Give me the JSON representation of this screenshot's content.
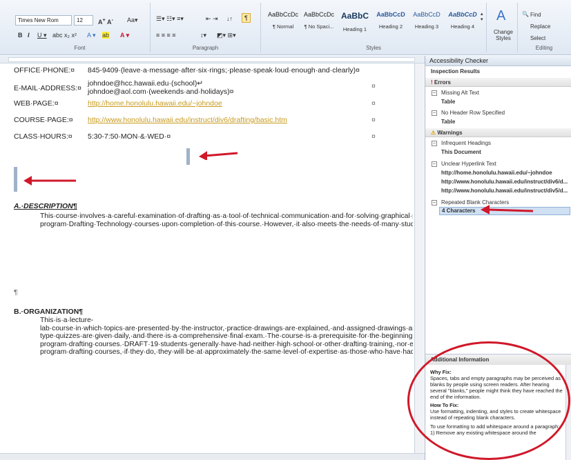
{
  "ribbon": {
    "font_name": "Times New Rom",
    "font_size": "12",
    "font_label": "Font",
    "paragraph_label": "Paragraph",
    "styles_label": "Styles",
    "editing_label": "Editing",
    "styles": [
      {
        "preview": "AaBbCcDc",
        "name": "¶ Normal"
      },
      {
        "preview": "AaBbCcDc",
        "name": "¶ No Spaci..."
      },
      {
        "preview": "AaBbC",
        "name": "Heading 1"
      },
      {
        "preview": "AaBbCcD",
        "name": "Heading 2"
      },
      {
        "preview": "AaBbCcD",
        "name": "Heading 3"
      },
      {
        "preview": "AaBbCcD",
        "name": "Heading 4"
      }
    ],
    "change_styles": "Change Styles",
    "find": "Find",
    "replace": "Replace",
    "select": "Select"
  },
  "document": {
    "office_phone_label": "OFFICE·PHONE:¤",
    "office_phone_value": "845-9409·(leave·a·message·after·six·rings;·please·speak·loud·enough·and·clearly)¤",
    "email_label": "E-MAIL·ADDRESS:¤",
    "email_value1": "johndoe@hcc.hawaii.edu·(school)↵",
    "email_value2": "johndoe@aol.com·(weekends·and·holidays)¤",
    "web_label": "WEB·PAGE:¤",
    "web_value": "http://home.honolulu.hawaii.edu/~johndoe",
    "course_label": "COURSE·PAGE:¤",
    "course_value": "http://www.honolulu.hawaii.edu/instruct/div6/drafting/basic.htm",
    "hours_label": "CLASS·HOURS:¤",
    "hours_value": "5:30-7:50·MON·&·WED·¤",
    "cell_mark": "¤",
    "pilcrow": "¶",
    "desc_heading": "A.·DESCRIPTION¶",
    "desc_text": "This·course·involves·a·careful·examination·of·drafting·as·a·tool·of·technical·communication·and·for·solving·graphical·problems.·Emphases·are·on·development·of·basic·drafting·skills,·visualization,·and·solution·of·spatial·problems.·It·is·an·exploratory,·first·course·in·drafting·designed·primarily·for·students·planning·to·enroll·in·the·regular-program·Drafting·Technology·courses·upon·completion·of·this·course.·However,·it·also·meets·the·needs·of·many·students·with·other·interests,·as·a·refresher·course·in·drafting,·a·course·for·upgrading·drafting·skills,·a·course·for·IED·students·training·to·be·public·school·industrial·arts·teachers,·or·a·course·that·provides·students·with·a·general·\"feel\"·for·the·subject·of·drafting.¶",
    "org_heading": "B.·ORGANIZATION¶",
    "org_text": "This·is·a·lecture-lab·course·in·which·topics·are·presented·by·the·instructor,·practice·drawings·are·explained,·and·assigned·drawings·are·completed·by·students·both·during·lab·periods·and·outside·of·class.·Objective·and·drawing-type·quizzes·are·given·daily,·and·there·is·a·comprehensive·final·exam.·The·course·is·a·prerequisite·for·the·beginning·regular-program·drafting·courses.·DRAFT·19·students·generally·have·had·neither·high·school·or·other·drafting·training,·nor·experience·in·drafting·employment.·So·when·students·in·this·course·proceed·to·the·regular-program·drafting·courses,·if·they·do,·they·will·be·at·approximately·the·same·level·of·expertise·as·those·who·have·had·previous·training·or·experience·and·who·are·permitted·to·waive·DRAFT·19.·This·basic·drafting·course·therefore·assumes·no·previous·drafting·experience·or·training,·so·the·initial·emphases·are·on·the·use·of·equipment·and·basic·procedures.¶"
  },
  "pane": {
    "title": "Accessibility Checker",
    "inspection_results": "Inspection Results",
    "errors_label": "Errors",
    "missing_alt": "Missing Alt Text",
    "missing_alt_item": "Table",
    "no_header": "No Header Row Specified",
    "no_header_item": "Table",
    "warnings_label": "Warnings",
    "infrequent": "Infrequent Headings",
    "infrequent_item": "This Document",
    "unclear": "Unclear Hyperlink Text",
    "unclear_items": [
      "http://home.honolulu.hawaii.edu/~johndoe",
      "http://www.honolulu.hawaii.edu/instruct/div6/d...",
      "http://www.honolulu.hawaii.edu/instruct/div5/d..."
    ],
    "repeated": "Repeated Blank Characters",
    "repeated_item": "4 Characters",
    "additional_info": "Additional Information",
    "why_fix": "Why Fix:",
    "why_text": "Spaces, tabs and empty paragraphs may be perceived as blanks by people using screen readers. After hearing several \"blanks,\" people might think they have reached the end of the information.",
    "how_fix": "How To Fix:",
    "how_text": "Use formatting, indenting, and styles to create whitespace instead of repeating blank characters.",
    "how_text2": "To use formatting to add whitespace around a paragraph:",
    "how_text3": "1) Remove any existing whitespace around the"
  },
  "colors": {
    "annotation_red": "#d0182a",
    "link": "#c79a1e"
  }
}
